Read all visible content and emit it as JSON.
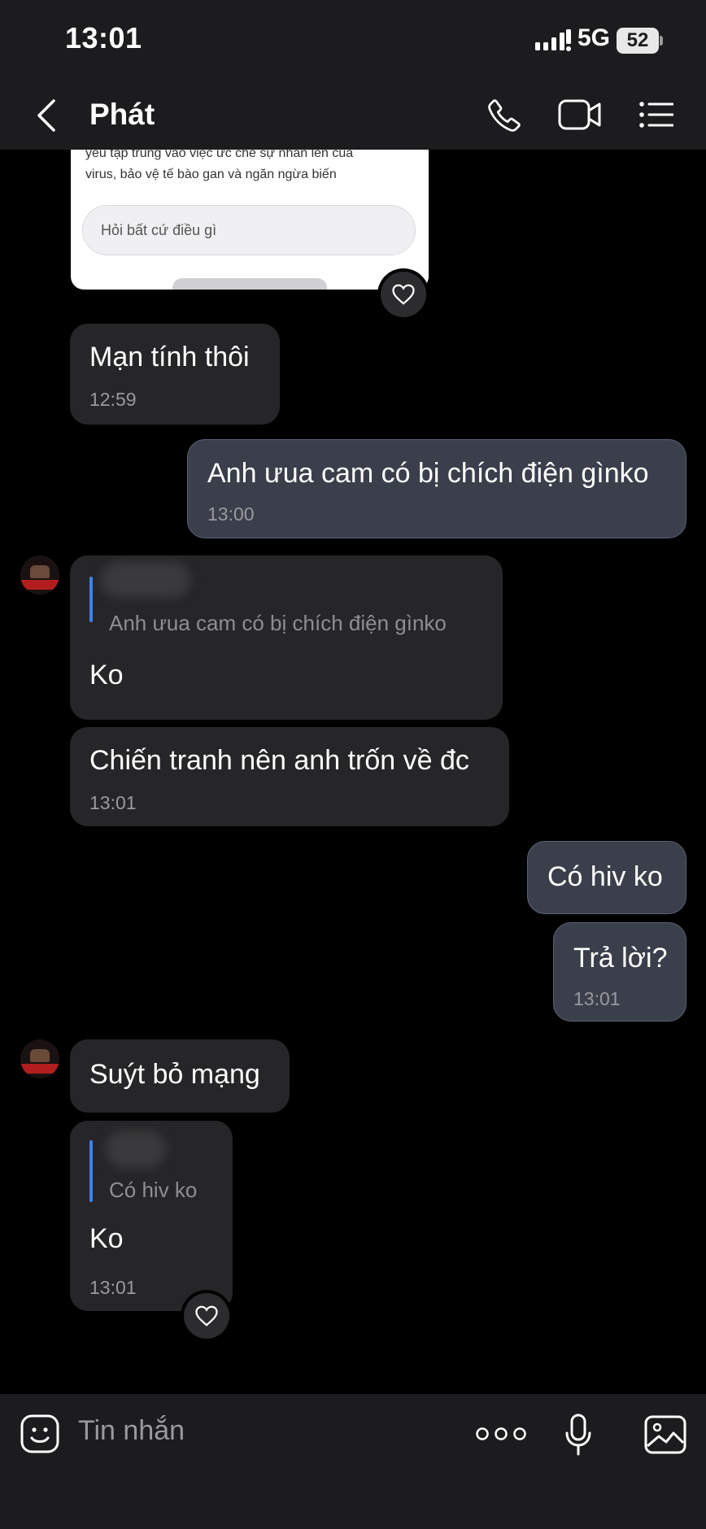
{
  "status_bar": {
    "time": "13:01",
    "network": "5G",
    "battery": "52"
  },
  "header": {
    "contact_name": "Phát"
  },
  "shared_image": {
    "line1": "yêu tập trung vào việc ức chế sự nhân lên của",
    "line2": "virus, bảo vệ tế bào gan và ngăn ngừa biến",
    "input_placeholder": "Hỏi bất cứ điều gì"
  },
  "messages": [
    {
      "id": "m1",
      "direction": "in",
      "text": "Mạn tính thôi",
      "time": "12:59"
    },
    {
      "id": "m2",
      "direction": "out",
      "text": "Anh ưua cam có bị chích điện gìnko",
      "time": "13:00"
    },
    {
      "id": "m3",
      "direction": "in",
      "quote": "Anh ưua cam có bị chích điện gìnko",
      "text": "Ko"
    },
    {
      "id": "m4",
      "direction": "in",
      "text": "Chiến tranh nên anh trốn về đc",
      "time": "13:01"
    },
    {
      "id": "m5",
      "direction": "out",
      "text": "Có hiv ko"
    },
    {
      "id": "m6",
      "direction": "out",
      "text": "Trả lời?",
      "time": "13:01"
    },
    {
      "id": "m7",
      "direction": "in",
      "text": "Suýt bỏ mạng"
    },
    {
      "id": "m8",
      "direction": "in",
      "quote": "Có hiv ko",
      "text": "Ko",
      "time": "13:01"
    }
  ],
  "composer": {
    "placeholder": "Tin nhắn"
  },
  "icons": [
    "back-icon",
    "call-icon",
    "video-icon",
    "menu-icon",
    "heart-icon",
    "sticker-icon",
    "more-icon",
    "mic-icon",
    "image-icon"
  ],
  "colors": {
    "header_bg": "#1c1c1e",
    "incoming_bubble": "#262628",
    "outgoing_bubble": "#3a3f4b",
    "quote_accent": "#3b82f6"
  }
}
